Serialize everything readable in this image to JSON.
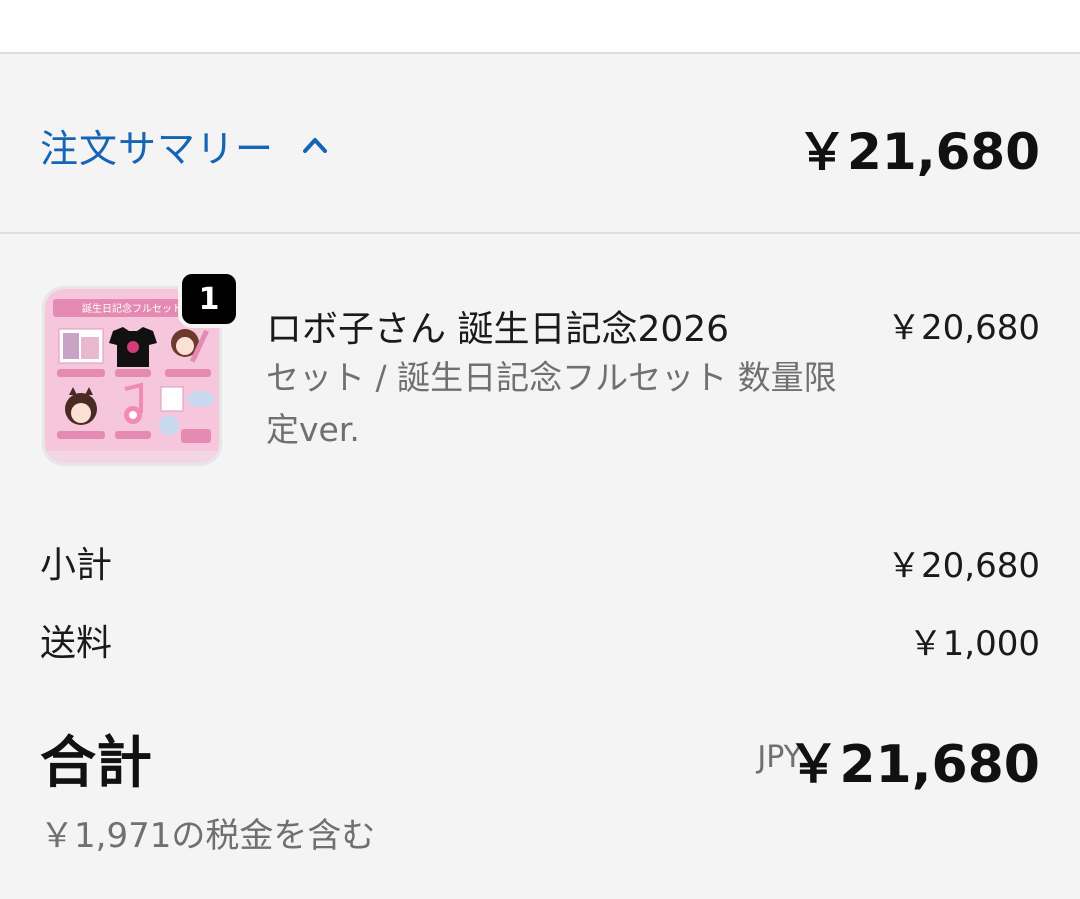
{
  "summary": {
    "toggle_label": "注文サマリー",
    "header_total": "￥21,680"
  },
  "item": {
    "quantity": "1",
    "title": "ロボ子さん 誕生日記念2026",
    "variant": "セット / 誕生日記念フルセット 数量限定ver.",
    "price": "￥20,680",
    "thumbnail_heading": "誕生日記念フルセット"
  },
  "lines": {
    "subtotal_label": "小計",
    "subtotal_value": "￥20,680",
    "shipping_label": "送料",
    "shipping_value": "￥1,000"
  },
  "total": {
    "label": "合計",
    "currency": "JPY",
    "value": "￥21,680",
    "tax_note": "￥1,971の税金を含む"
  },
  "colors": {
    "link_blue": "#1665b5",
    "muted_text": "#707070",
    "background": "#f4f4f4",
    "thumbnail_pink": "#f6c6dc"
  },
  "icons": {
    "toggle": "chevron-up-icon"
  }
}
